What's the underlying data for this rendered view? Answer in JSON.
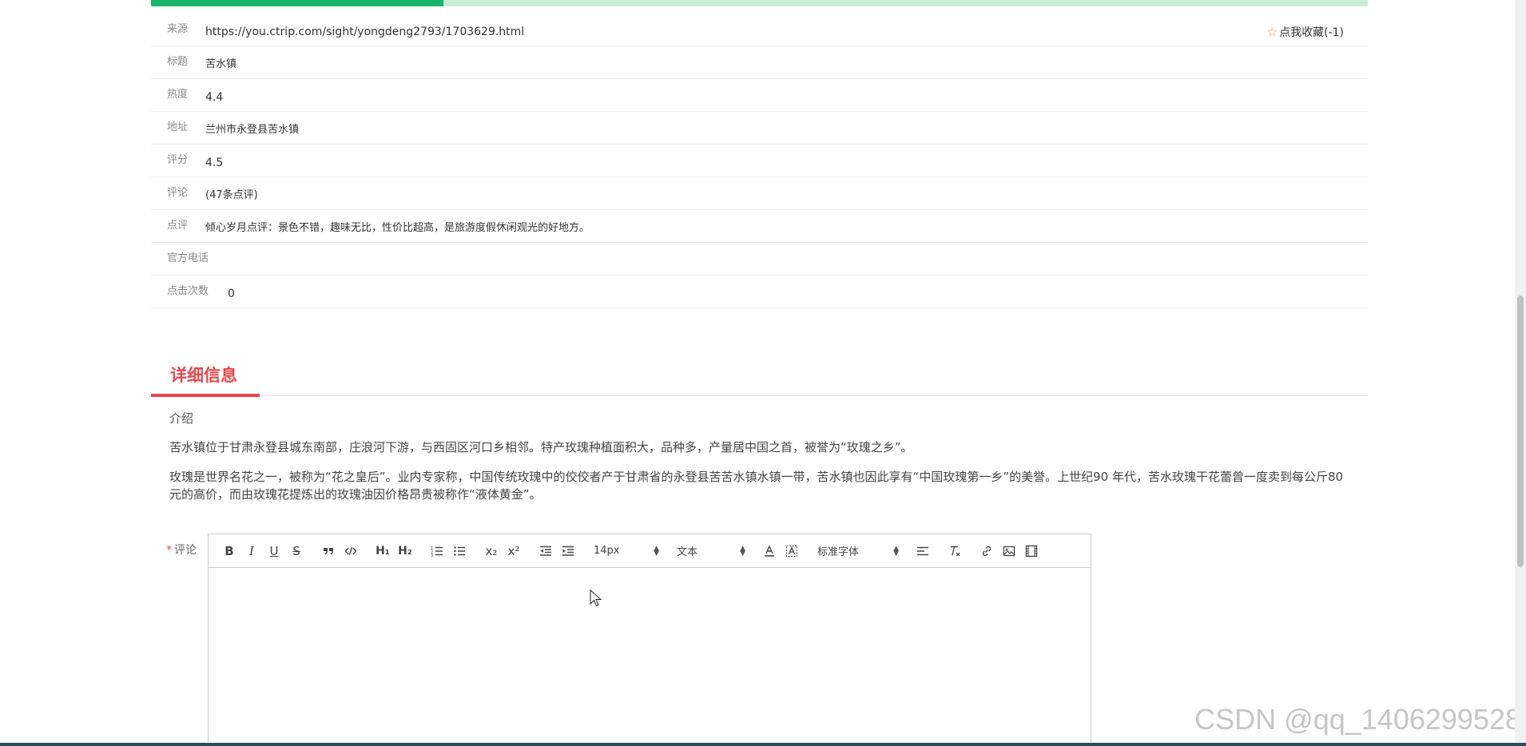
{
  "progress": {
    "value_fraction": 0.24
  },
  "info": {
    "source": {
      "label": "来源",
      "value": "https://you.ctrip.com/sight/yongdeng2793/1703629.html"
    },
    "favorite": {
      "text": "点我收藏(-1)"
    },
    "title": {
      "label": "标题",
      "value": "苦水镇"
    },
    "heat": {
      "label": "热度",
      "value": "4.4"
    },
    "address": {
      "label": "地址",
      "value": "兰州市永登县苦水镇"
    },
    "rating": {
      "label": "评分",
      "value": "4.5"
    },
    "comments": {
      "label": "评论",
      "value": "(47条点评)"
    },
    "review": {
      "label": "点评",
      "value": "倾心岁月点评：景色不错，趣味无比，性价比超高，是旅游度假休闲观光的好地方。"
    },
    "phone": {
      "label": "官方电话",
      "value": ""
    },
    "clicks": {
      "label": "点击次数",
      "value": "0"
    }
  },
  "detail": {
    "section_title": "详细信息",
    "intro_label": "介绍",
    "paragraphs": [
      "苦水镇位于甘肃永登县城东南部，庄浪河下游，与西固区河口乡相邻。特产玫瑰种植面积大，品种多，产量居中国之首，被誉为“玫瑰之乡”。",
      "玫瑰是世界名花之一，被称为“花之皇后”。业内专家称，中国传统玫瑰中的佼佼者产于甘肃省的永登县苦苦水镇水镇一带，苦水镇也因此享有“中国玫瑰第一乡”的美誉。上世纪90 年代，苦水玫瑰干花蕾曾一度卖到每公斤80元的高价，而由玫瑰花提炼出的玫瑰油因价格昂贵被称作“液体黄金”。"
    ]
  },
  "comment_form": {
    "required_mark": "*",
    "label": "评论",
    "toolbar": {
      "bold": "B",
      "italic": "I",
      "underline": "U",
      "strike": "S",
      "h1": "H₁",
      "h2": "H₂",
      "subscript": "x₂",
      "superscript": "x²",
      "size": "14px",
      "header": "文本",
      "font": "标准字体"
    }
  },
  "watermark": "CSDN @qq_1406299528",
  "colors": {
    "accent": "#e6474c",
    "progress_fill": "#19b36b",
    "progress_track": "#c8ecd8",
    "star": "#f08a3c"
  }
}
